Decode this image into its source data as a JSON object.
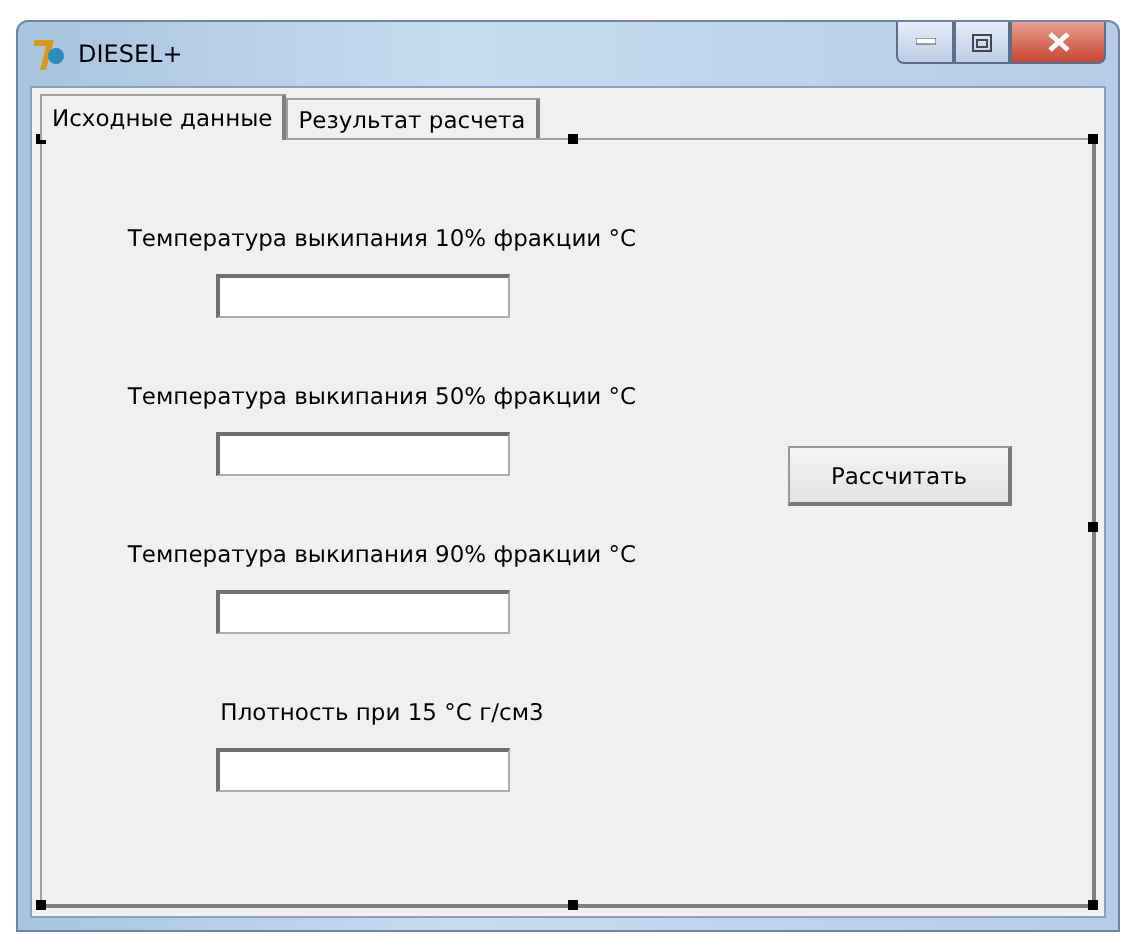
{
  "window": {
    "title": "DIESEL+"
  },
  "tabs": [
    {
      "label": "Исходные данные",
      "selected": true
    },
    {
      "label": "Результат расчета",
      "selected": false
    }
  ],
  "fields": [
    {
      "label": "Температура выкипания 10% фракции °C"
    },
    {
      "label": "Температура выкипания 50% фракции °C"
    },
    {
      "label": "Температура выкипания 90% фракции °C"
    },
    {
      "label": "Плотность при 15 °C г/см3"
    }
  ],
  "button": {
    "label": "Рассчитать"
  }
}
